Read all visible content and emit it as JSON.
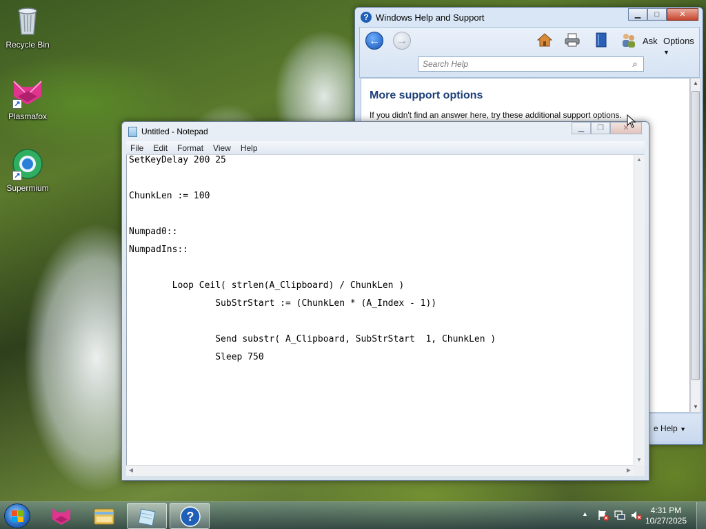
{
  "desktop": {
    "icons": [
      {
        "label": "Recycle Bin"
      },
      {
        "label": "Plasmafox"
      },
      {
        "label": "Supermium"
      }
    ]
  },
  "help_window": {
    "title": "Windows Help and Support",
    "toolbar": {
      "ask_label": "Ask",
      "options_label": "Options"
    },
    "search": {
      "placeholder": "Search Help"
    },
    "content": {
      "heading": "More support options",
      "subtext": "If you didn't find an answer here, try these additional support options."
    },
    "footer": {
      "options_label": "e Help"
    }
  },
  "notepad": {
    "title": "Untitled - Notepad",
    "menu": [
      "File",
      "Edit",
      "Format",
      "View",
      "Help"
    ],
    "lines": [
      "SetKeyDelay 200 25",
      "",
      "ChunkLen := 100",
      "",
      "Numpad0::",
      "NumpadIns::",
      "",
      "        Loop Ceil( strlen(A_Clipboard) / ChunkLen )",
      "                SubStrStart := (ChunkLen * (A_Index - 1))",
      "",
      "                Send substr( A_Clipboard, SubStrStart  1, ChunkLen )",
      "                Sleep 750"
    ]
  },
  "taskbar": {
    "clock_time": "4:31 PM",
    "clock_date": "10/27/2025"
  },
  "colors": {
    "help_heading": "#1e3f78",
    "link_blue": "#1a55c4",
    "close_red": "#c7452d"
  }
}
